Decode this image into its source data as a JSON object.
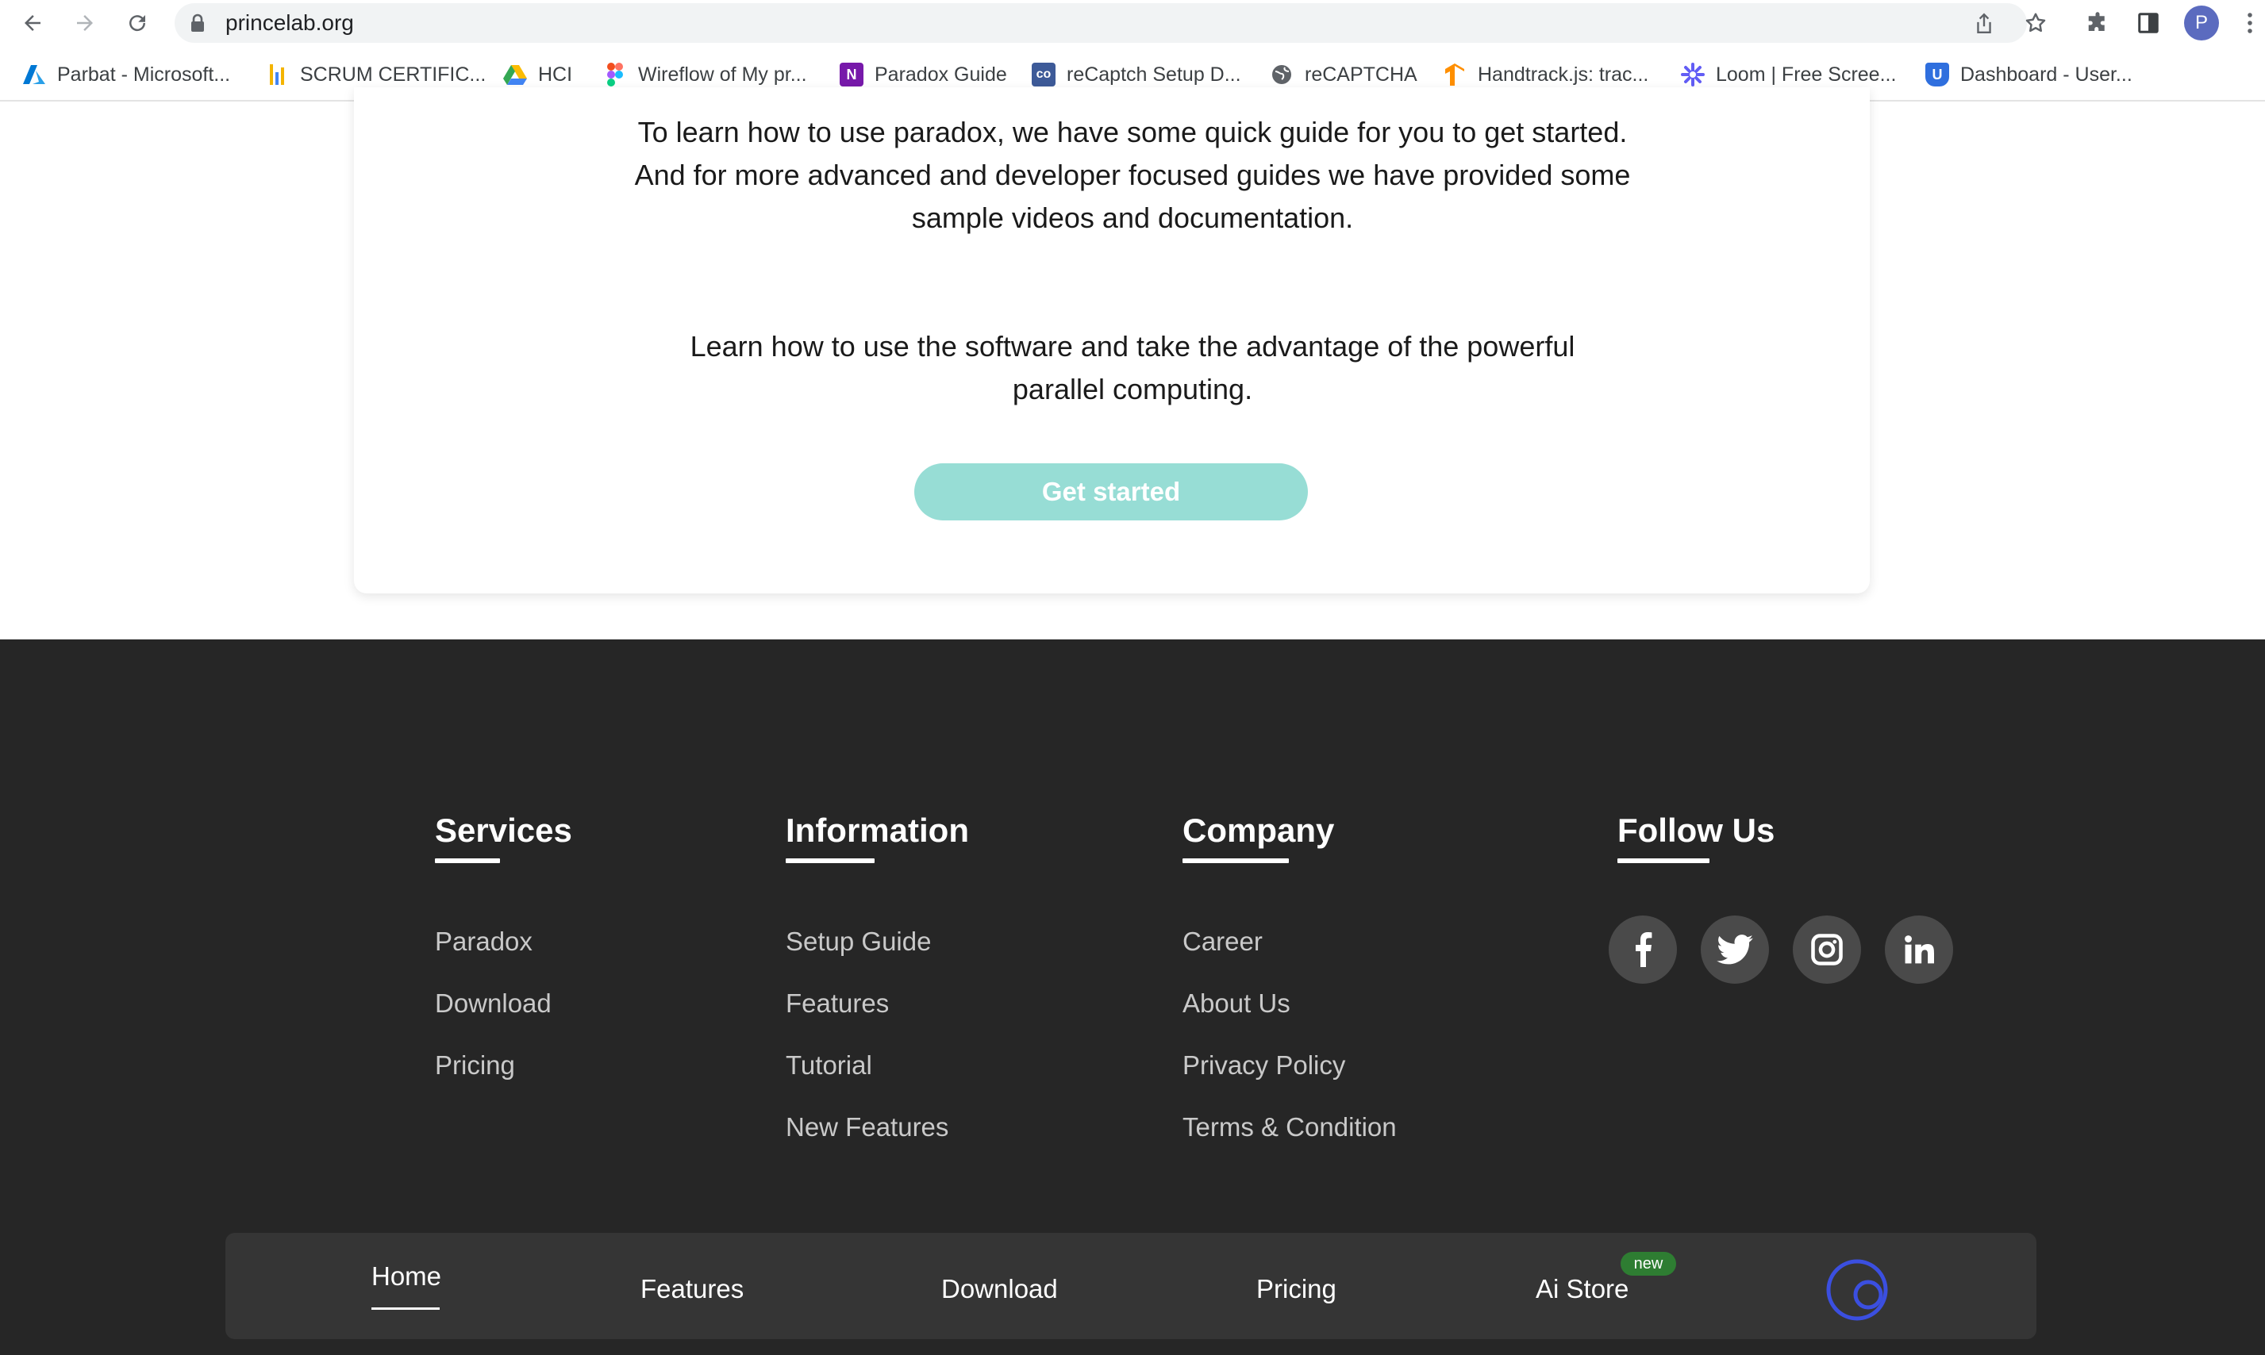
{
  "browser": {
    "url": "princelab.org",
    "profile_initial": "P",
    "bookmarks": [
      {
        "label": "Parbat - Microsoft...",
        "icon": "azure-icon",
        "color": "#0078d4"
      },
      {
        "label": "SCRUM CERTIFIC...",
        "icon": "chart-bars-icon",
        "color": "#f4b400"
      },
      {
        "label": "HCI",
        "icon": "google-drive-icon",
        "color": "#34a853"
      },
      {
        "label": "Wireflow of My pr...",
        "icon": "figma-icon",
        "color": "#f24e1e"
      },
      {
        "label": "Paradox Guide",
        "icon": "onenote-icon",
        "color": "#7719aa"
      },
      {
        "label": "reCaptch Setup D...",
        "icon": "link-icon",
        "color": "#3d5a98"
      },
      {
        "label": "reCAPTCHA",
        "icon": "globe-icon",
        "color": "#5f6368"
      },
      {
        "label": "Handtrack.js: trac...",
        "icon": "tensorflow-icon",
        "color": "#ff8f00"
      },
      {
        "label": "Loom | Free Scree...",
        "icon": "loom-icon",
        "color": "#625df5"
      },
      {
        "label": "Dashboard - User...",
        "icon": "shield-u-icon",
        "color": "#2f6fde"
      }
    ]
  },
  "intro": {
    "line1": "To learn how to use paradox, we have some quick guide for you to get started.",
    "line2": "And for more advanced and developer focused guides we have provided some",
    "line3": "sample videos and documentation.",
    "line4": "Learn how to use the software and take the advantage of the powerful",
    "line5": "parallel computing.",
    "cta_label": "Get started"
  },
  "footer": {
    "services": {
      "title": "Services",
      "links": [
        "Paradox",
        "Download",
        "Pricing"
      ]
    },
    "information": {
      "title": "Information",
      "links": [
        "Setup Guide",
        "Features",
        "Tutorial",
        "New Features"
      ]
    },
    "company": {
      "title": "Company",
      "links": [
        "Career",
        "About Us",
        "Privacy Policy",
        "Terms & Condition"
      ]
    },
    "follow": {
      "title": "Follow Us",
      "icons": [
        "facebook-icon",
        "twitter-icon",
        "instagram-icon",
        "linkedin-icon"
      ]
    }
  },
  "bottom_nav": {
    "items": [
      "Home",
      "Features",
      "Download",
      "Pricing",
      "Ai Store"
    ],
    "active": "Home",
    "badge": "new",
    "logo_icon": "paradox-logo-icon",
    "logo_color": "#3b4fe0"
  },
  "colors": {
    "footer_bg": "#262626",
    "cta_bg": "#97ddd5",
    "badge_bg": "#2e7d32"
  }
}
